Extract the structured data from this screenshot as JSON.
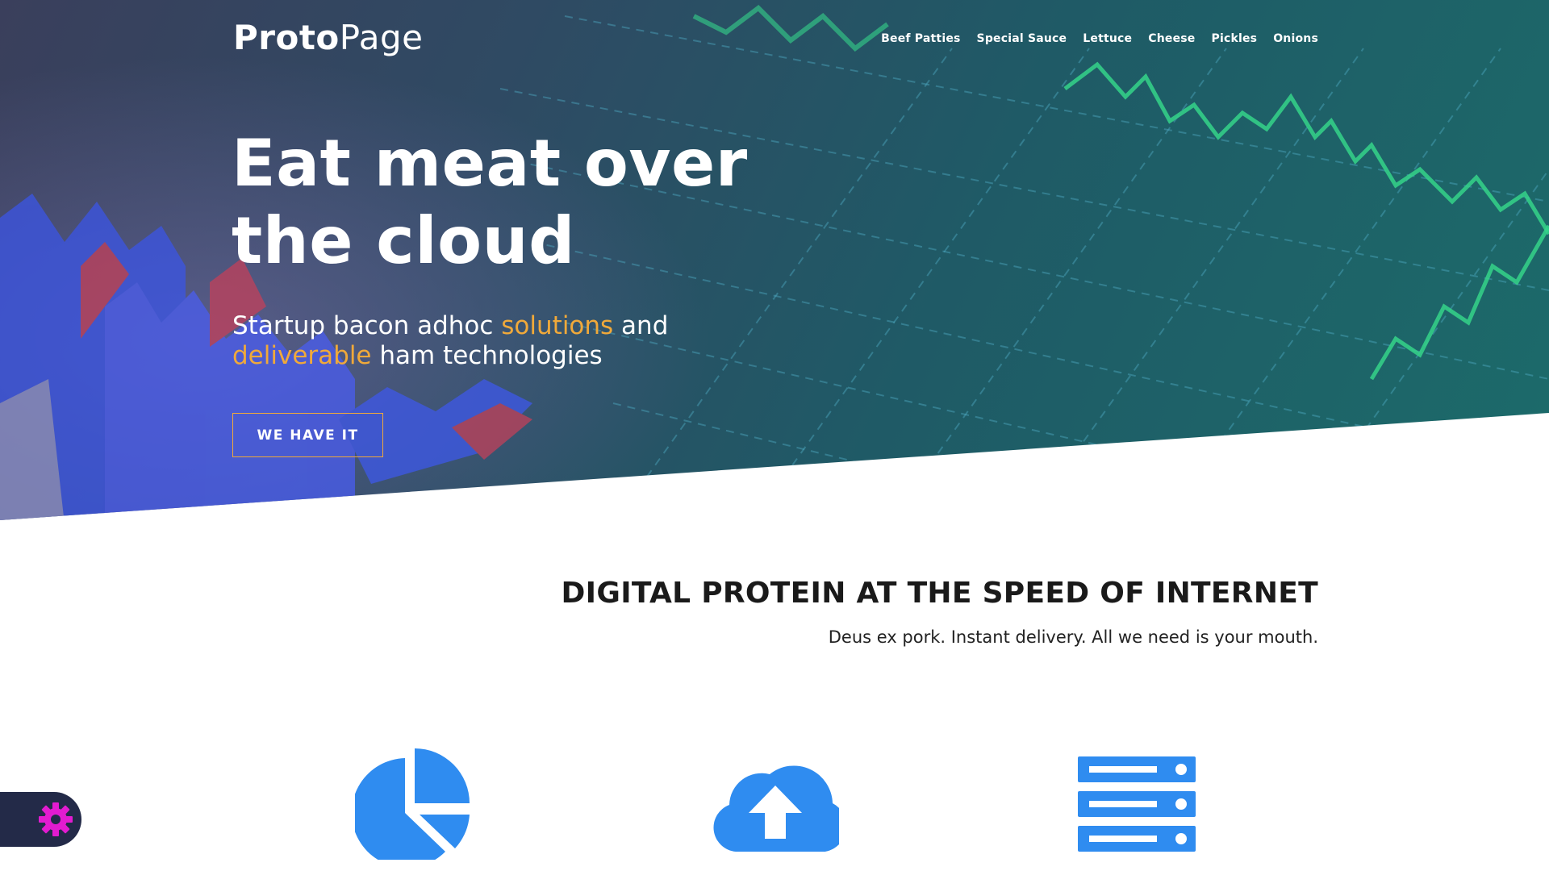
{
  "header": {
    "logo_bold": "Proto",
    "logo_light": "Page",
    "nav": [
      {
        "label": "Beef Patties"
      },
      {
        "label": "Special Sauce"
      },
      {
        "label": "Lettuce"
      },
      {
        "label": "Cheese"
      },
      {
        "label": "Pickles"
      },
      {
        "label": "Onions"
      }
    ]
  },
  "hero": {
    "title_line1": "Eat meat over",
    "title_line2": "the cloud",
    "subtitle_part1": "Startup bacon adhoc ",
    "subtitle_highlight1": "solutions",
    "subtitle_part2": " and",
    "subtitle_highlight2": "deliverable",
    "subtitle_part3": " ham technologies",
    "cta_label": "WE HAVE IT"
  },
  "section": {
    "title": "DIGITAL PROTEIN AT THE SPEED OF INTERNET",
    "subtitle": "Deus ex pork. Instant delivery. All we need is your mouth."
  },
  "features": [
    {
      "icon": "pie-chart-icon"
    },
    {
      "icon": "cloud-upload-icon"
    },
    {
      "icon": "server-icon"
    }
  ],
  "settings": {
    "icon": "gear-icon"
  },
  "colors": {
    "accent": "#f0a93a",
    "icon_blue": "#2f8cf0",
    "settings_bg": "#232a48",
    "gear": "#e21bd0"
  }
}
